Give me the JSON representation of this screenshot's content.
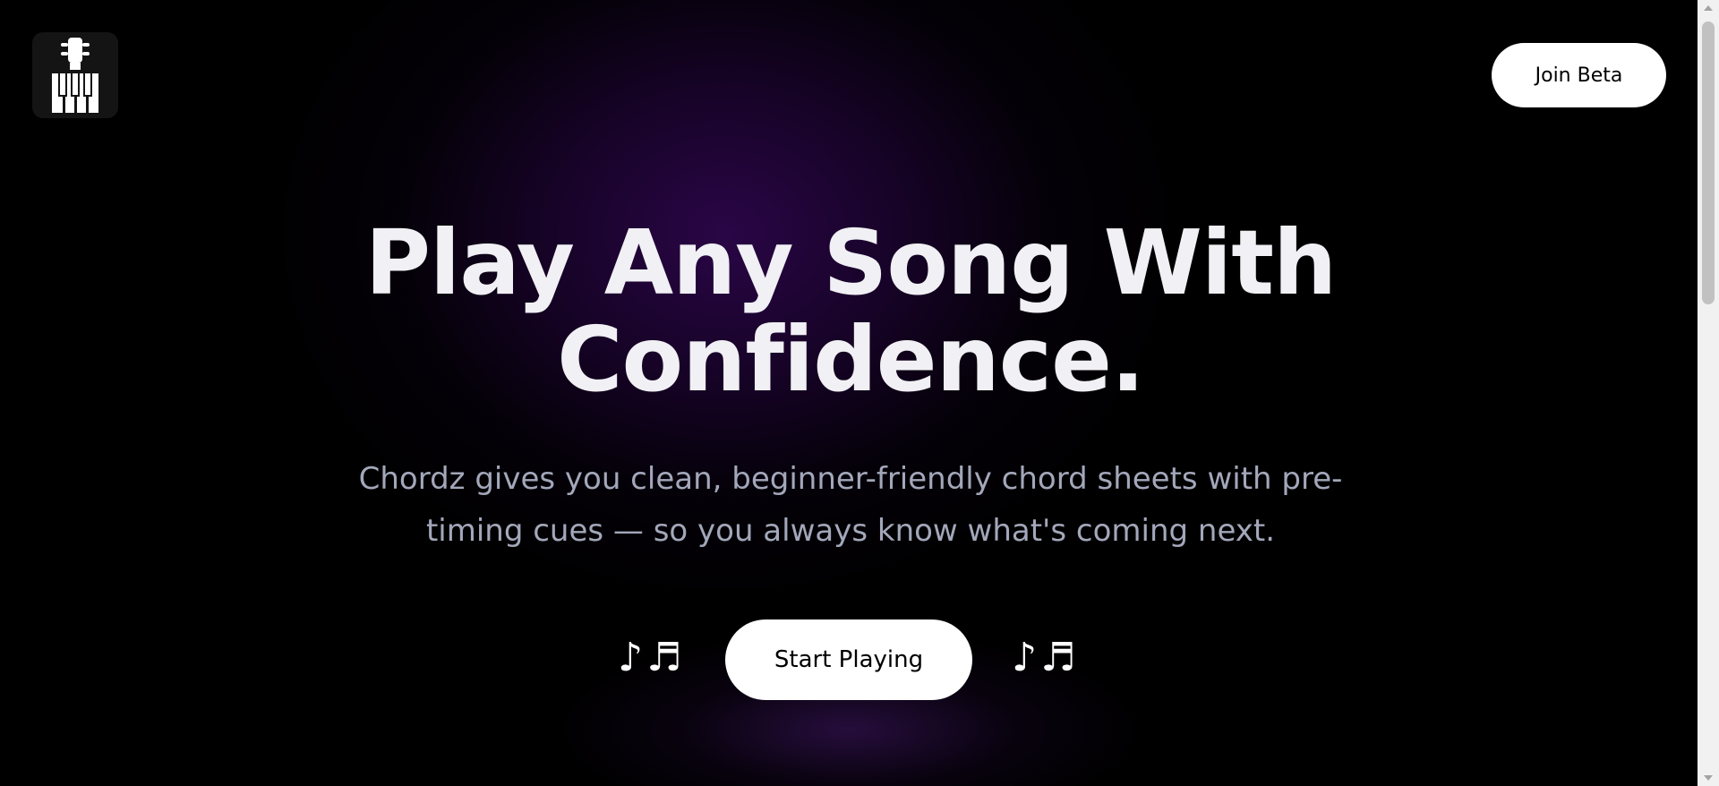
{
  "header": {
    "logo_icon": "guitar-piano-logo-icon",
    "join_label": "Join Beta"
  },
  "hero": {
    "headline_line1": "Play Any Song With",
    "headline_line2": "Confidence.",
    "subtitle_line1": "Chordz gives you clean, beginner-friendly chord sheets with pre-",
    "subtitle_line2": "timing cues — so you always know what's coming next.",
    "notes_left": "♪♬",
    "notes_right": "♪♬",
    "cta_label": "Start Playing"
  },
  "colors": {
    "background": "#000000",
    "glow": "#2c064a",
    "headline": "#f1f0f4",
    "subtitle": "#a3a7ba",
    "button_bg": "#ffffff",
    "button_text": "#000000"
  }
}
